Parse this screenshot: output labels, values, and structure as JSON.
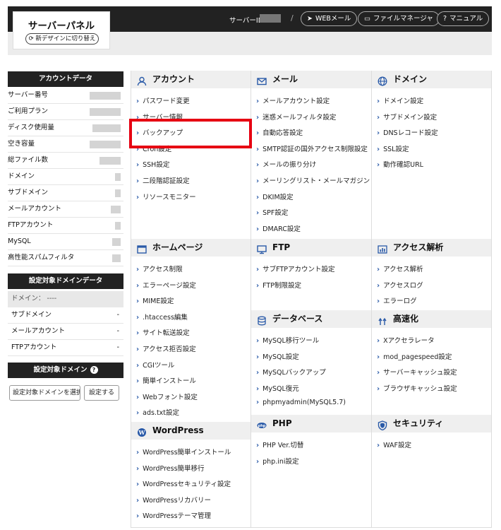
{
  "header": {
    "logo_title": "サーバーパネル",
    "switch_label": "新デザインに切り替え",
    "server_id_label": "サーバーID",
    "slash": "/",
    "buttons": {
      "webmail": "WEBメール",
      "filemanager": "ファイルマネージャ",
      "manual": "マニュアル"
    }
  },
  "sidebar": {
    "account_title": "アカウントデータ",
    "account_rows": [
      {
        "label": "サーバー番号"
      },
      {
        "label": "ご利用プラン"
      },
      {
        "label": "ディスク使用量"
      },
      {
        "label": "空き容量"
      },
      {
        "label": "総ファイル数"
      },
      {
        "label": "ドメイン"
      },
      {
        "label": "サブドメイン"
      },
      {
        "label": "メールアカウント"
      },
      {
        "label": "FTPアカウント"
      },
      {
        "label": "MySQL"
      },
      {
        "label": "高性能スパムフィルタ"
      }
    ],
    "domain_data_title": "設定対象ドメインデータ",
    "domain_label": "ドメイン： ----",
    "domain_rows": [
      {
        "label": "サブドメイン",
        "value": "-"
      },
      {
        "label": "メールアカウント",
        "value": "-"
      },
      {
        "label": "FTPアカウント",
        "value": "-"
      }
    ],
    "target_domain_title": "設定対象ドメイン",
    "select_value": "設定対象ドメインを選択",
    "set_button": "設定する"
  },
  "categories": {
    "account": {
      "title": "アカウント",
      "links": [
        "パスワード変更",
        "サーバー情報",
        "バックアップ",
        "Cron設定",
        "SSH設定",
        "二段階認証設定",
        "リソースモニター"
      ]
    },
    "mail": {
      "title": "メール",
      "links": [
        "メールアカウント設定",
        "迷惑メールフィルタ設定",
        "自動応答設定",
        "SMTP認証の国外アクセス制限設定",
        "メールの振り分け",
        "メーリングリスト・メールマガジン",
        "DKIM設定",
        "SPF設定",
        "DMARC設定"
      ]
    },
    "domain": {
      "title": "ドメイン",
      "links": [
        "ドメイン設定",
        "サブドメイン設定",
        "DNSレコード設定",
        "SSL設定",
        "動作確認URL"
      ]
    },
    "homepage": {
      "title": "ホームページ",
      "links": [
        "アクセス制限",
        "エラーページ設定",
        "MIME設定",
        ".htaccess編集",
        "サイト転送設定",
        "アクセス拒否設定",
        "CGIツール",
        "簡単インストール",
        "Webフォント設定",
        "ads.txt設定"
      ]
    },
    "ftp": {
      "title": "FTP",
      "links": [
        "サブFTPアカウント設定",
        "FTP制限設定"
      ]
    },
    "access": {
      "title": "アクセス解析",
      "links": [
        "アクセス解析",
        "アクセスログ",
        "エラーログ"
      ]
    },
    "database": {
      "title": "データベース",
      "links": [
        "MySQL移行ツール",
        "MySQL設定",
        "MySQLバックアップ",
        "MySQL復元",
        "phpmyadmin(MySQL5.7)"
      ]
    },
    "speed": {
      "title": "高速化",
      "links": [
        "Xアクセラレータ",
        "mod_pagespeed設定",
        "サーバーキャッシュ設定",
        "ブラウザキャッシュ設定"
      ]
    },
    "wordpress": {
      "title": "WordPress",
      "links": [
        "WordPress簡単インストール",
        "WordPress簡単移行",
        "WordPressセキュリティ設定",
        "WordPressリカバリー",
        "WordPressテーマ管理"
      ]
    },
    "php": {
      "title": "PHP",
      "links": [
        "PHP Ver.切替",
        "php.ini設定"
      ]
    },
    "security": {
      "title": "セキュリティ",
      "links": [
        "WAF設定"
      ]
    }
  },
  "colors": {
    "highlight": "#e60012",
    "icon_blue": "#2a5aa8",
    "header_bg": "#222222"
  }
}
